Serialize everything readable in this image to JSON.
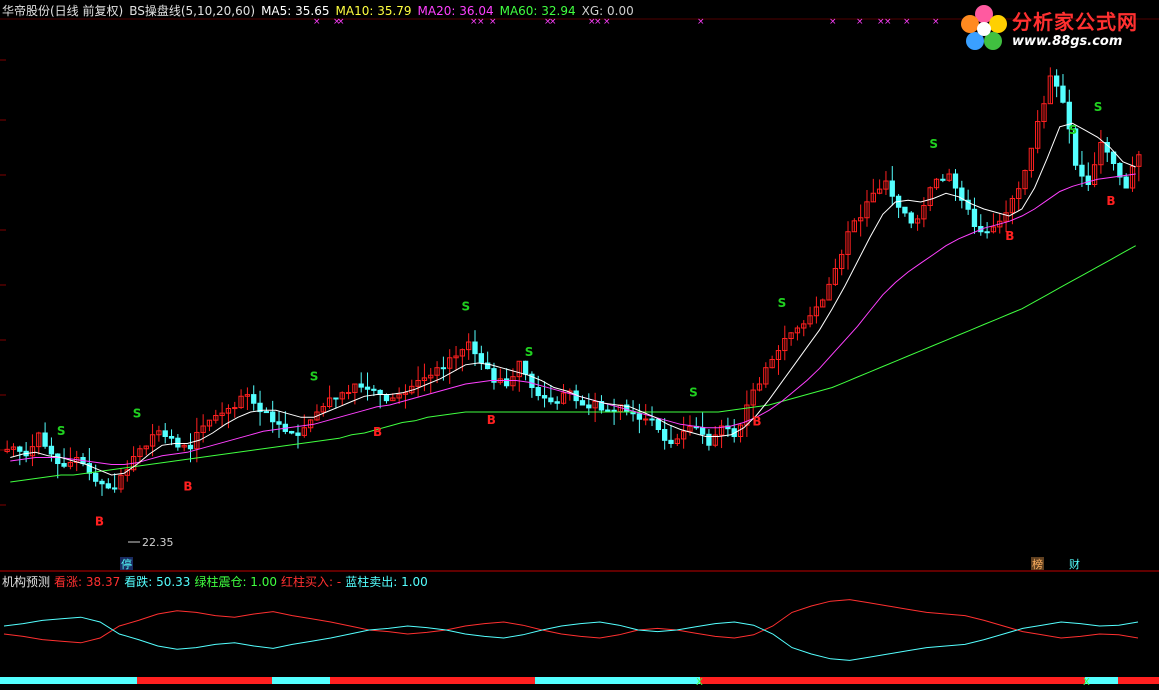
{
  "header": {
    "title": "华帝股份(日线 前复权)",
    "indicator": "BS操盘线(5,10,20,60)",
    "ma5": "MA5: 35.65",
    "ma10": "MA10: 35.79",
    "ma20": "MA20: 36.04",
    "ma60": "MA60: 32.94",
    "xg": "XG: 0.00"
  },
  "logo": {
    "title": "分析家公式网",
    "url": "www.88gs.com"
  },
  "lower_header": {
    "name": "机构预测",
    "up": "看涨: 38.37",
    "down": "看跌: 50.33",
    "green": "绿柱震仓: 1.00",
    "red": "红柱买入: -",
    "blue": "蓝柱卖出: 1.00"
  },
  "colors": {
    "background": "#000000",
    "up_candle": "#ff2020",
    "down_candle": "#54ffff",
    "ma5": "#ffffff",
    "ma10": "#ffff40",
    "ma20": "#ff40ff",
    "ma60": "#40ff40",
    "grid": "#800000",
    "signal_s": "#20d020",
    "signal_b": "#ff2020"
  },
  "markers": {
    "low_label": "22.35",
    "event1": "停",
    "event2": "榜",
    "event3": "财",
    "signal_s": "S",
    "signal_b": "B",
    "xg_mark": "×",
    "bar_mark": "X"
  },
  "chart_data": [
    {
      "type": "candlestick",
      "title": "华帝股份(日线 前复权)",
      "close": [
        25.6,
        25.1,
        26.4,
        25.2,
        24.5,
        25.0,
        24.1,
        23.5,
        23.2,
        24.3,
        25.5,
        26.3,
        26.2,
        25.6,
        25.5,
        26.8,
        27.4,
        27.8,
        28.5,
        28.1,
        27.6,
        26.9,
        26.4,
        26.7,
        27.6,
        28.4,
        28.7,
        29.2,
        28.9,
        28.6,
        28.4,
        28.7,
        29.4,
        29.7,
        30.1,
        30.8,
        31.6,
        30.4,
        29.3,
        29.1,
        30.5,
        29.0,
        28.4,
        28.1,
        28.8,
        28.0,
        28.2,
        27.7,
        28.0,
        27.5,
        27.2,
        26.6,
        25.8,
        26.5,
        26.7,
        25.7,
        26.8,
        26.2,
        28.0,
        29.2,
        30.6,
        31.8,
        32.4,
        33.1,
        34.0,
        35.8,
        37.9,
        38.7,
        40.1,
        40.8,
        39.3,
        38.4,
        39.4,
        40.9,
        41.2,
        39.7,
        38.2,
        37.9,
        38.5,
        39.8,
        41.4,
        44.2,
        46.8,
        45.3,
        41.7,
        40.6,
        43.0,
        41.8,
        40.4,
        42.3
      ],
      "ma5": [
        25.0,
        25.2,
        25.3,
        25.1,
        25.0,
        24.8,
        24.6,
        24.3,
        24.0,
        24.1,
        24.6,
        25.2,
        25.7,
        25.8,
        25.8,
        26.0,
        26.4,
        26.9,
        27.3,
        27.6,
        27.7,
        27.7,
        27.5,
        27.3,
        27.3,
        27.6,
        27.9,
        28.2,
        28.5,
        28.6,
        28.6,
        28.7,
        28.9,
        29.2,
        29.5,
        29.9,
        30.3,
        30.4,
        30.3,
        30.1,
        29.9,
        29.7,
        29.4,
        29.0,
        28.8,
        28.5,
        28.3,
        28.1,
        28.0,
        27.9,
        27.6,
        27.3,
        26.9,
        26.6,
        26.4,
        26.2,
        26.2,
        26.3,
        26.7,
        27.4,
        28.3,
        29.3,
        30.3,
        31.3,
        32.3,
        33.5,
        34.8,
        36.2,
        37.6,
        38.9,
        39.6,
        39.7,
        39.6,
        39.8,
        40.1,
        39.9,
        39.5,
        39.2,
        39.0,
        38.8,
        39.2,
        40.4,
        42.1,
        43.9,
        44.1,
        43.7,
        43.3,
        42.7,
        41.9,
        41.6
      ],
      "ma20": [
        24.8,
        24.9,
        25.0,
        25.0,
        25.0,
        24.9,
        24.8,
        24.7,
        24.6,
        24.6,
        24.7,
        24.9,
        25.1,
        25.2,
        25.3,
        25.5,
        25.7,
        25.9,
        26.1,
        26.3,
        26.5,
        26.6,
        26.7,
        26.8,
        26.9,
        27.1,
        27.3,
        27.5,
        27.7,
        27.9,
        28.0,
        28.2,
        28.4,
        28.6,
        28.8,
        29.0,
        29.2,
        29.3,
        29.4,
        29.4,
        29.4,
        29.3,
        29.1,
        28.9,
        28.7,
        28.5,
        28.3,
        28.1,
        27.9,
        27.7,
        27.5,
        27.3,
        27.1,
        26.9,
        26.8,
        26.7,
        26.7,
        26.8,
        27.0,
        27.3,
        27.7,
        28.2,
        28.8,
        29.4,
        30.1,
        30.9,
        31.7,
        32.5,
        33.4,
        34.3,
        35.0,
        35.6,
        36.1,
        36.6,
        37.1,
        37.5,
        37.8,
        38.1,
        38.3,
        38.5,
        38.8,
        39.2,
        39.7,
        40.2,
        40.5,
        40.7,
        40.9,
        41.0,
        41.1,
        41.2
      ],
      "ma60": [
        23.6,
        23.7,
        23.8,
        23.9,
        24.0,
        24.0,
        24.1,
        24.2,
        24.3,
        24.4,
        24.5,
        24.6,
        24.7,
        24.8,
        24.9,
        25.0,
        25.1,
        25.2,
        25.3,
        25.4,
        25.5,
        25.6,
        25.7,
        25.8,
        25.9,
        26.0,
        26.1,
        26.3,
        26.4,
        26.6,
        26.8,
        27.0,
        27.1,
        27.3,
        27.4,
        27.5,
        27.6,
        27.6,
        27.6,
        27.6,
        27.6,
        27.6,
        27.6,
        27.6,
        27.6,
        27.6,
        27.6,
        27.6,
        27.6,
        27.6,
        27.6,
        27.6,
        27.6,
        27.6,
        27.6,
        27.6,
        27.6,
        27.7,
        27.8,
        27.9,
        28.0,
        28.2,
        28.4,
        28.6,
        28.8,
        29.0,
        29.3,
        29.6,
        29.9,
        30.2,
        30.5,
        30.8,
        31.1,
        31.4,
        31.7,
        32.0,
        32.3,
        32.6,
        32.9,
        33.2,
        33.5,
        33.9,
        34.3,
        34.7,
        35.1,
        35.5,
        35.9,
        36.3,
        36.7,
        37.1
      ],
      "low_marked": 22.35
    },
    {
      "type": "line",
      "title": "机构预测",
      "series": [
        {
          "name": "看涨",
          "values": [
            45,
            42,
            38,
            36,
            34,
            40,
            55,
            62,
            70,
            74,
            72,
            68,
            66,
            70,
            73,
            68,
            64,
            60,
            55,
            50,
            48,
            45,
            47,
            50,
            55,
            58,
            60,
            56,
            50,
            45,
            42,
            40,
            44,
            50,
            52,
            50,
            46,
            42,
            40,
            44,
            55,
            72,
            80,
            86,
            88,
            84,
            80,
            76,
            72,
            70,
            68,
            62,
            55,
            48,
            44,
            40,
            42,
            45,
            44,
            40
          ]
        },
        {
          "name": "看跌",
          "values": [
            55,
            58,
            62,
            64,
            66,
            60,
            45,
            38,
            30,
            26,
            28,
            32,
            34,
            30,
            27,
            32,
            36,
            40,
            45,
            50,
            52,
            55,
            53,
            50,
            45,
            42,
            40,
            44,
            50,
            55,
            58,
            60,
            56,
            50,
            48,
            50,
            54,
            58,
            60,
            56,
            45,
            28,
            20,
            14,
            12,
            16,
            20,
            24,
            28,
            30,
            32,
            38,
            45,
            52,
            56,
            60,
            58,
            55,
            56,
            60
          ]
        }
      ]
    }
  ]
}
